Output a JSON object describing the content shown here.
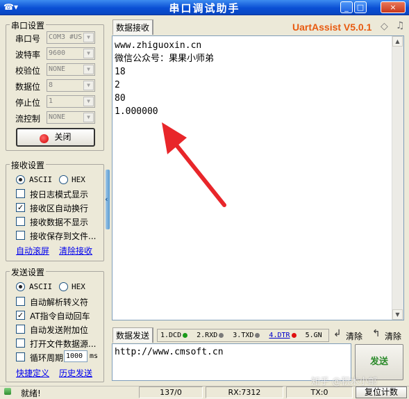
{
  "window": {
    "title": "串口调试助手",
    "min_label": "_",
    "max_label": "□",
    "close_label": "×",
    "menu_icon": "☎▾"
  },
  "serial_settings": {
    "title": "串口设置",
    "fields": [
      {
        "label": "串口号",
        "value": "COM3 #US"
      },
      {
        "label": "波特率",
        "value": "9600"
      },
      {
        "label": "校验位",
        "value": "NONE"
      },
      {
        "label": "数据位",
        "value": "8"
      },
      {
        "label": "停止位",
        "value": "1"
      },
      {
        "label": "流控制",
        "value": "NONE"
      }
    ],
    "open_button": "关闭"
  },
  "receive_settings": {
    "title": "接收设置",
    "ascii": "ASCII",
    "hex": "HEX",
    "options": [
      {
        "label": "按日志模式显示",
        "checked": false
      },
      {
        "label": "接收区自动换行",
        "checked": true
      },
      {
        "label": "接收数据不显示",
        "checked": false
      },
      {
        "label": "接收保存到文件...",
        "checked": false
      }
    ],
    "auto_scroll": "自动滚屏",
    "clear_receive": "清除接收"
  },
  "send_settings": {
    "title": "发送设置",
    "ascii": "ASCII",
    "hex": "HEX",
    "options": [
      {
        "label": "自动解析转义符",
        "checked": false
      },
      {
        "label": "AT指令自动回车",
        "checked": true
      },
      {
        "label": "自动发送附加位",
        "checked": false
      },
      {
        "label": "打开文件数据源...",
        "checked": false
      },
      {
        "label": "循环周期",
        "checked": false
      }
    ],
    "period_value": "1000",
    "period_unit": "ms",
    "shortcut": "快捷定义",
    "history": "历史发送"
  },
  "receive_area": {
    "tab": "数据接收",
    "brand": "UartAssist V5.0.1",
    "lines": [
      "www.zhiguoxin.cn",
      "微信公众号：果果小师弟",
      "18",
      "2",
      "80",
      "1.000000"
    ]
  },
  "send_area": {
    "tab": "数据发送",
    "indicators": [
      {
        "label": "1.DCD",
        "color": "#1a9a1a"
      },
      {
        "label": "2.RXD",
        "color": "#7a7a7a"
      },
      {
        "label": "3.TXD",
        "color": "#7a7a7a"
      },
      {
        "label": "4.DTR",
        "color": "#e01010"
      },
      {
        "label": "5.GN",
        "color": ""
      }
    ],
    "clear1": "清除",
    "clear2": "清除",
    "text": "http://www.cmsoft.cn",
    "send_button": "发送"
  },
  "status_bar": {
    "ready": "就绪!",
    "count": "137/0",
    "rx": "RX:7312",
    "tx": "TX:0",
    "reset": "复位计数"
  },
  "watermark": "知乎 @积木小邮"
}
